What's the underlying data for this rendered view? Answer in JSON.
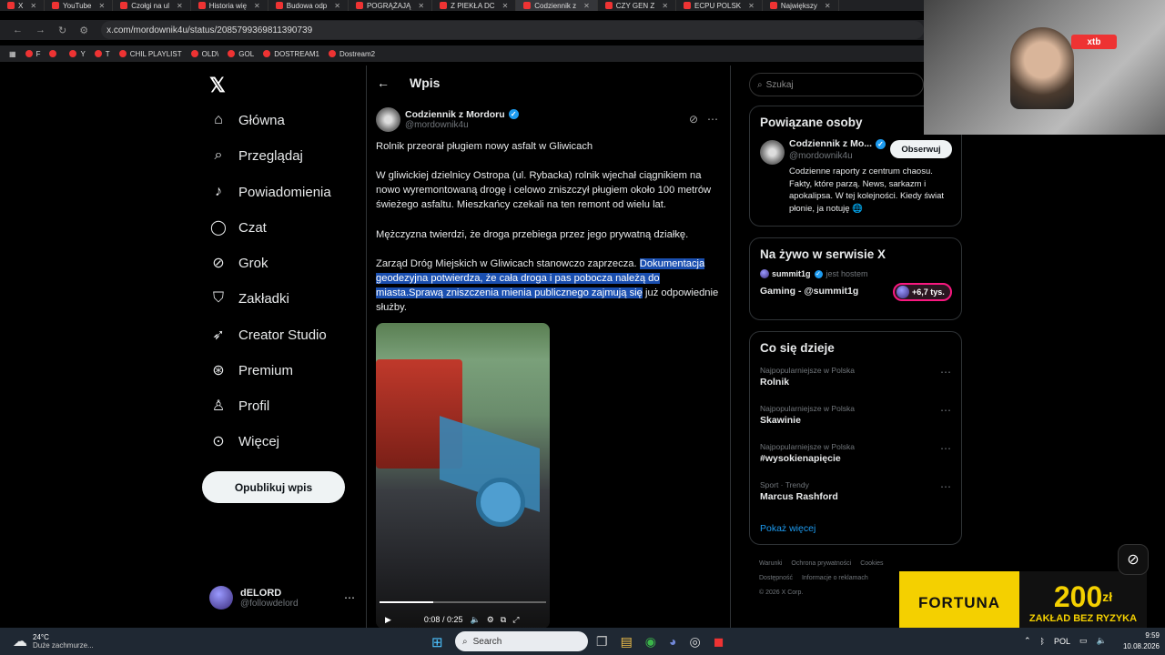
{
  "browser": {
    "tabs": [
      {
        "label": "X",
        "active": false
      },
      {
        "label": "YouTube",
        "active": false
      },
      {
        "label": "Czołgi na ul",
        "active": false
      },
      {
        "label": "Historia wię",
        "active": false
      },
      {
        "label": "Budowa odp",
        "active": false
      },
      {
        "label": "POGRĄŻAJĄ",
        "active": false
      },
      {
        "label": "Z PIEKŁA DC",
        "active": false
      },
      {
        "label": "Codziennik z",
        "active": true
      },
      {
        "label": "CZY GEN Z",
        "active": false
      },
      {
        "label": "ECPU POLSK",
        "active": false
      },
      {
        "label": "Największy",
        "active": false
      }
    ],
    "url": "x.com/mordownik4u/status/2085799369811390739",
    "bookmarks": [
      "F",
      "",
      "Y",
      "T",
      "CHIL PLAYLIST",
      "OLD\\",
      "GOL",
      "DOSTREAM1",
      "Dostream2"
    ]
  },
  "nav": {
    "items": [
      {
        "label": "Główna",
        "icon": "home-icon",
        "glyph": "⌂"
      },
      {
        "label": "Przeglądaj",
        "icon": "search-icon",
        "glyph": "⌕"
      },
      {
        "label": "Powiadomienia",
        "icon": "bell-icon",
        "glyph": "♪"
      },
      {
        "label": "Czat",
        "icon": "chat-icon",
        "glyph": "◯"
      },
      {
        "label": "Grok",
        "icon": "grok-icon",
        "glyph": "⊘"
      },
      {
        "label": "Zakładki",
        "icon": "bookmark-icon",
        "glyph": "⛉"
      },
      {
        "label": "Creator Studio",
        "icon": "rocket-icon",
        "glyph": "➶"
      },
      {
        "label": "Premium",
        "icon": "premium-icon",
        "glyph": "⊛"
      },
      {
        "label": "Profil",
        "icon": "profile-icon",
        "glyph": "♙"
      },
      {
        "label": "Więcej",
        "icon": "more-icon",
        "glyph": "⊙"
      }
    ],
    "post_button": "Opublikuj wpis",
    "account": {
      "name": "dELORD",
      "handle": "@followdelord",
      "more": "⋯"
    }
  },
  "post": {
    "header_title": "Wpis",
    "author_name": "Codziennik z Mordoru",
    "author_handle": "@mordownik4u",
    "p1": "Rolnik przeorał pługiem nowy asfalt w Gliwicach",
    "p2": "W gliwickiej dzielnicy Ostropa (ul. Rybacka) rolnik wjechał ciągnikiem na nowo wyremontowaną drogę i celowo zniszczył pługiem około 100 metrów świeżego asfaltu. Mieszkańcy czekali na ten remont od wielu lat.",
    "p3": "Mężczyzna twierdzi, że droga przebiega przez jego prywatną działkę.",
    "p4_plain": "Zarząd Dróg Miejskich w Gliwicach stanowczo zaprzecza. ",
    "p4_highlight": "Dokumentacja geodezyjna potwierdza, że cała droga i pas pobocza należą do miasta.Sprawą zniszczenia mienia publicznego zajmują się",
    "p4_tail": " już odpowiednie służby.",
    "video_time": "0:08 / 0:25",
    "video_progress": 0.32
  },
  "right": {
    "search_placeholder": "Szukaj",
    "related": {
      "title": "Powiązane osoby",
      "name": "Codziennik z Mo...",
      "handle": "@mordownik4u",
      "follow": "Obserwuj",
      "bio": "Codzienne raporty z centrum chaosu. Fakty, które parzą. News, sarkazm i apokalipsa. W tej kolejności. Kiedy świat płonie, ja notuję 🌐"
    },
    "live": {
      "title": "Na żywo w serwisie X",
      "host": "summit1g",
      "host_suffix": "jest hostem",
      "stream": "Gaming - @summit1g",
      "viewers": "+6,7 tys."
    },
    "trends": {
      "title": "Co się dzieje",
      "items": [
        {
          "meta": "Najpopularniejsze w Polska",
          "name": "Rolnik"
        },
        {
          "meta": "Najpopularniejsze w Polska",
          "name": "Skawinie"
        },
        {
          "meta": "Najpopularniejsze w Polska",
          "name": "#wysokienapięcie"
        },
        {
          "meta": "Sport · Trendy",
          "name": "Marcus Rashford"
        }
      ],
      "more": "Pokaż więcej"
    },
    "footer": [
      "Warunki",
      "Ochrona prywatności",
      "Cookies",
      "Dostępność",
      "Informacje o reklamach",
      "© 2026 X Corp."
    ]
  },
  "overlay": {
    "brand": "FORTUNA",
    "amount": "200",
    "currency": "zł",
    "promo": "ZAKŁAD BEZ RYZYKA",
    "xtb": "xtb"
  },
  "taskbar": {
    "weather_temp": "24°C",
    "weather_desc": "Duże zachmurze...",
    "search": "Search",
    "lang": "POL",
    "time": "9:59",
    "date": "10.08.2026"
  }
}
